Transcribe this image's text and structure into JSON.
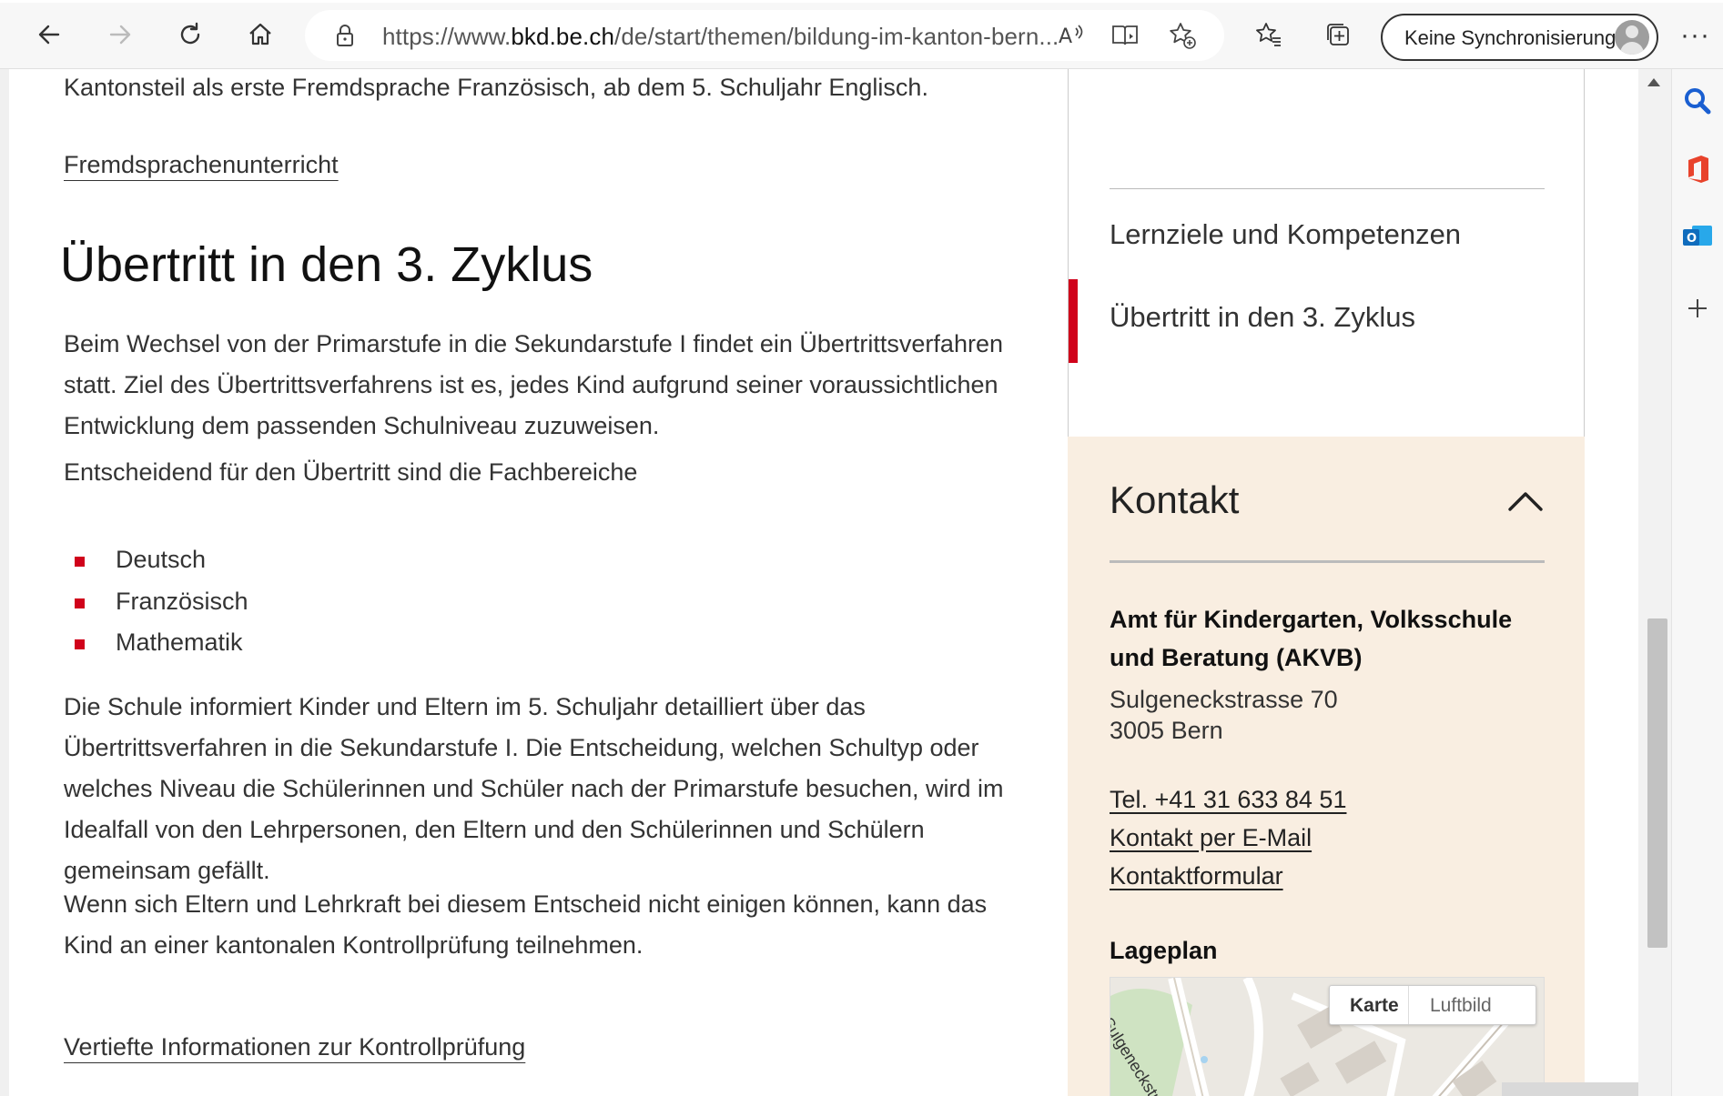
{
  "browser": {
    "url_prefix": "https://www.",
    "url_domain": "bkd.be.ch",
    "url_rest": "/de/start/themen/bildung-im-kanton-bern...",
    "sync_label": "Keine Synchronisierung",
    "more_label": "···"
  },
  "main": {
    "intro_text": "Kantonsteil als erste Fremdsprache Französisch, ab dem 5. Schuljahr Englisch.",
    "link_fremdsprachen": "Fremdsprachenunterricht",
    "heading": "Übertritt in den 3. Zyklus",
    "para1": "Beim Wechsel von der Primarstufe in die Sekundarstufe I findet ein Übertrittsverfahren statt. Ziel des Übertrittsverfahrens ist es, jedes Kind aufgrund seiner voraussichtlichen Entwicklung dem passenden Schulniveau zuzuweisen.",
    "para2": "Entscheidend für den Übertritt sind die Fachbereiche",
    "subjects": [
      "Deutsch",
      "Französisch",
      "Mathematik"
    ],
    "para3": "Die Schule informiert Kinder und Eltern im 5. Schuljahr detailliert über das Übertrittsverfahren in die Sekundarstufe I. Die Entscheidung, welchen Schultyp oder welches Niveau die Schülerinnen und Schüler nach der Primarstufe besuchen, wird im Idealfall von den Lehrpersonen, den Eltern und den Schülerinnen und Schülern gemeinsam gefällt.",
    "para4": "Wenn sich Eltern und Lehrkraft bei diesem Entscheid nicht einigen können, kann das Kind an einer kantonalen Kontrollprüfung teilnehmen.",
    "link_kontrollpruefung": "Vertiefte Informationen zur Kontrollprüfung"
  },
  "sidenav": {
    "items": [
      "Lernziele und Kompetenzen",
      "Übertritt in den 3. Zyklus"
    ],
    "active_index": 1
  },
  "contact": {
    "title": "Kontakt",
    "org": "Amt für Kindergarten, Volksschule und Beratung (AKVB)",
    "street": "Sulgeneckstrasse 70",
    "city": "3005 Bern",
    "phone": "Tel. +41 31 633 84 51",
    "email_link": "Kontakt per E-Mail",
    "form_link": "Kontaktformular",
    "map_title": "Lageplan",
    "map_tab_map": "Karte",
    "map_tab_aerial": "Luftbild",
    "map_street_label": "Sulgeneckstr"
  },
  "colors": {
    "accent_red": "#d0021b",
    "contact_bg": "#f9eee1"
  }
}
